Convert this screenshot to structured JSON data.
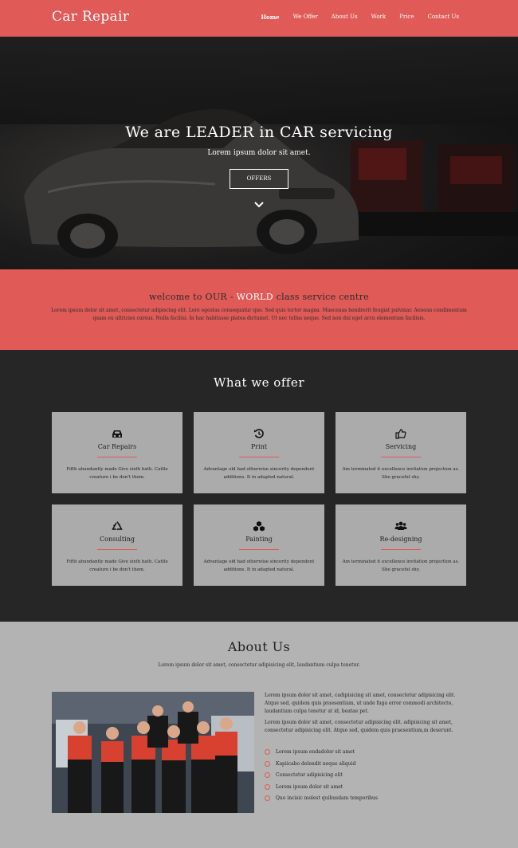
{
  "brand": "Car Repair",
  "nav": [
    "Home",
    "We Offer",
    "About Us",
    "Work",
    "Price",
    "Contact Us"
  ],
  "hero": {
    "title": "We are LEADER in CAR servicing",
    "subtitle": "Lorem ipsum dolor sit amet.",
    "button": "OFFERS"
  },
  "welcome": {
    "prefix": "welcome to ",
    "our": "OUR",
    "sep": " - ",
    "world": "WORLD",
    "suffix": " class service centre",
    "text": "Lorem ipsum dolor sit amet, consectetur adipiscing elit. Lore egestas consequatur que. Sed quis tortor magna. Maecenas hendrerit feugiat pulvinar. Aenean condimentum quam eu ultricies cursus. Nulla facilisi. In hac habitasse platea dictumst. Ut nec tellus neque. Sed non dui eget arcu elementum facilisis."
  },
  "offer": {
    "title": "What we offer",
    "cards": [
      {
        "name": "Car Repairs",
        "desc": "Fifth abundantly made Give sixth hath. Cattle creature i be don't them.",
        "icon": "car-icon"
      },
      {
        "name": "Print",
        "desc": "Advantage old had otherwise sincerity dependent additions. It in adapted natural.",
        "icon": "history-icon"
      },
      {
        "name": "Servicing",
        "desc": "Am terminated it excellence invitation projection as. She graceful shy.",
        "icon": "thumbs-up-icon"
      },
      {
        "name": "Consulting",
        "desc": "Fifth abundantly made Give sixth hath. Cattle creature i be don't them.",
        "icon": "recycle-icon"
      },
      {
        "name": "Painting",
        "desc": "Advantage old had otherwise sincerity dependent additions. It in adapted natural.",
        "icon": "cubes-icon"
      },
      {
        "name": "Re-designing",
        "desc": "Am terminated it excellence invitation projection as. She graceful shy.",
        "icon": "users-icon"
      }
    ]
  },
  "about": {
    "title": "About Us",
    "subtitle": "Lorem ipsum dolor sit amet, consectetur adipisicing elit, laudantium culpa tenetur.",
    "p1": "Lorem ipsum dolor sit amet, cadipisicing sit amet, consectetur adipisicing elit. Atque sed, quidem quis praesentium, ut unde fuga error commodi architecto, laudantium culpa tenetur at id, beatae pet.",
    "p2": "Lorem ipsum dolor sit amet, consectetur adipisicing elit. adipisicing sit amet, consectetur adipisicing elit. Atque sed, quidem quis praesentium,m deserunt.",
    "list": [
      "Lorem ipsum endadolor sit amet",
      "Kapiicabo delendit neque aliquid",
      "Consectetur adipisicing elit",
      "Lorem ipsum dolor sit amet",
      "Quo incisic molest quibusdam temporibus"
    ]
  }
}
